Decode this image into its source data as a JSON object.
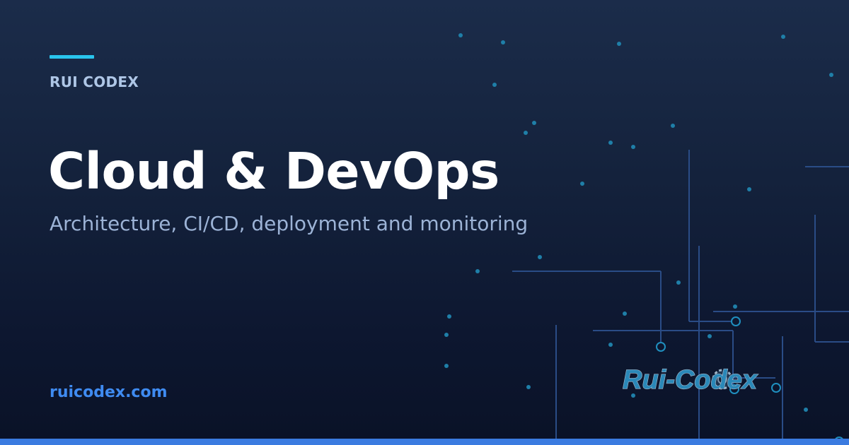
{
  "card": {
    "brand": "RUI CODEX",
    "title": "Cloud & DevOps",
    "subtitle": "Architecture, CI/CD, deployment and monitoring",
    "url": "ruicodex.com",
    "logo_text": "Rui-Codex",
    "logo_icon": "gear-icon"
  },
  "colors": {
    "accent": "#29c4ec",
    "link": "#3f8bf1",
    "bottom_bar": "#3b7be0",
    "background_top": "#1b2c4a",
    "background_bottom": "#0a1227",
    "circuit": "#2a4c86",
    "circuit_dot": "#1f7fa8"
  }
}
